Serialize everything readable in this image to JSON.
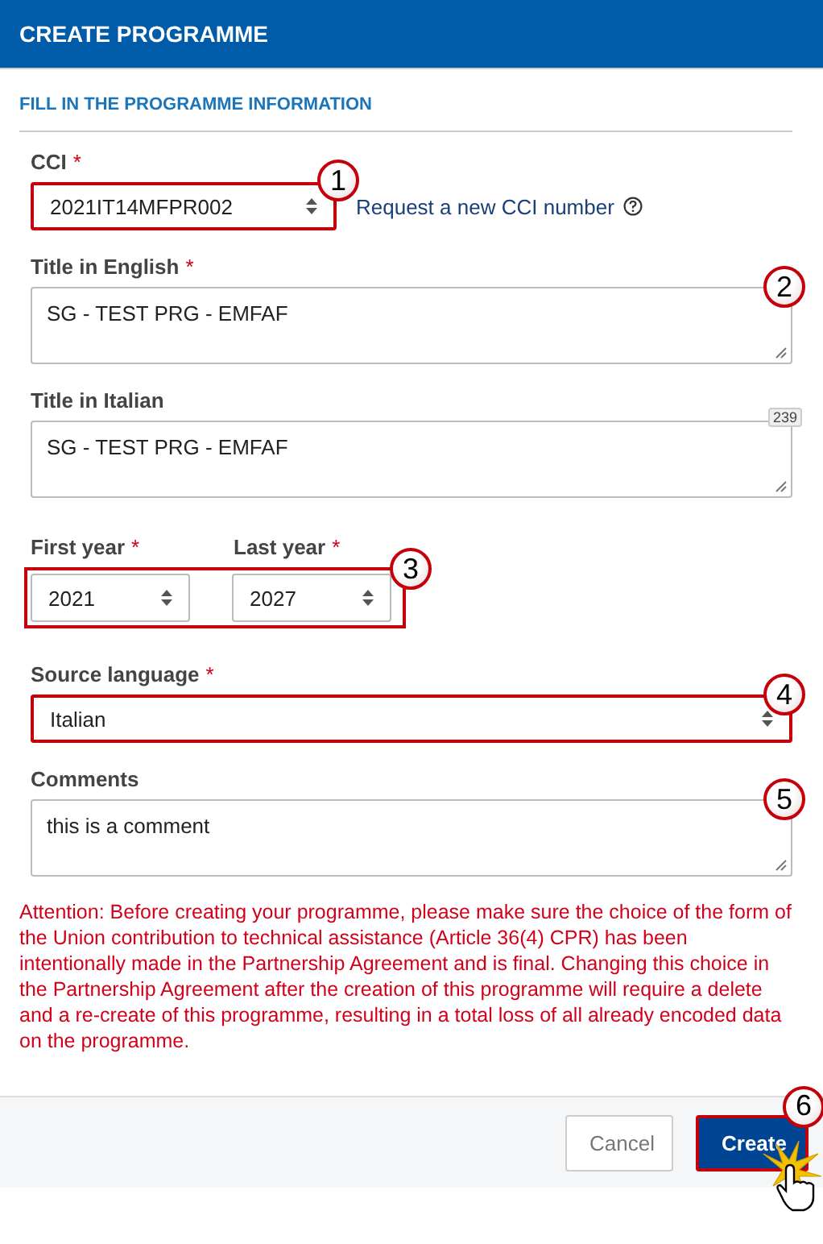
{
  "header": {
    "title": "CREATE PROGRAMME"
  },
  "section_title": "FILL IN THE PROGRAMME INFORMATION",
  "cci": {
    "label": "CCI",
    "required_mark": "*",
    "value": "2021IT14MFPR002",
    "callout": "1",
    "link": "Request a new CCI number"
  },
  "title_english": {
    "label": "Title in English",
    "required_mark": "*",
    "value": "SG - TEST PRG - EMFAF",
    "callout": "2"
  },
  "title_italian": {
    "label": "Title in Italian",
    "value": "SG - TEST PRG - EMFAF",
    "counter": "239"
  },
  "years": {
    "callout": "3",
    "fields": [
      {
        "label": "First year",
        "required_mark": "*",
        "value": "2021"
      },
      {
        "label": "Last year",
        "required_mark": "*",
        "value": "2027"
      }
    ]
  },
  "source_language": {
    "label": "Source language",
    "required_mark": "*",
    "value": "Italian",
    "callout": "4"
  },
  "comments": {
    "label": "Comments",
    "value": "this is a comment",
    "callout": "5"
  },
  "warning": "Attention: Before creating your programme, please make sure the choice of the form of the Union contribution to technical assistance (Article 36(4) CPR) has been intentionally made in the Partnership Agreement and is final. Changing this choice in the Partnership Agreement after the creation of this programme will require a delete and a re-create of this programme, resulting in a total loss of all already encoded data on the programme.",
  "buttons": [
    {
      "label": "Cancel",
      "kind": "secondary"
    },
    {
      "label": "Create",
      "kind": "primary",
      "callout": "6"
    }
  ]
}
